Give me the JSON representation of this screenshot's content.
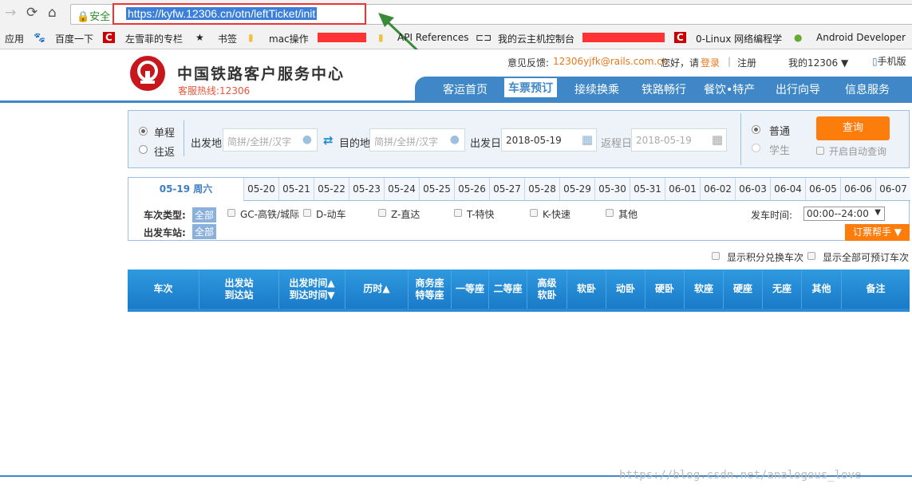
{
  "browser": {
    "secure_label": "安全",
    "url": "https://kyfw.12306.cn/otn/leftTicket/init",
    "bookmarks": [
      "应用",
      "百度一下",
      "左雪菲的专栏",
      "书签",
      "mac操作",
      "API References",
      "我的云主机控制台",
      "0-Linux 网络编程学",
      "Android Developer"
    ]
  },
  "header": {
    "logo_title": "中国铁路客户服务中心",
    "hotline": "客服热线:12306",
    "feedback_label": "意见反馈:",
    "feedback_email": "12306yjfk@rails.com.cn",
    "greeting": "您好，请",
    "login": "登录",
    "sep": "|",
    "register": "注册",
    "my12306": "我的12306",
    "mobile": "手机版",
    "nav": [
      "客运首页",
      "车票预订",
      "接续换乘",
      "铁路畅行",
      "餐饮•特产",
      "出行向导",
      "信息服务"
    ],
    "active_nav": "车票预订"
  },
  "search": {
    "one_way": "单程",
    "round_trip": "往返",
    "from_label": "出发地",
    "from_placeholder": "简拼/全拼/汉字",
    "to_label": "目的地",
    "to_placeholder": "简拼/全拼/汉字",
    "depart_label": "出发日",
    "depart_date": "2018-05-19",
    "return_label": "返程日",
    "return_date": "2018-05-19",
    "normal": "普通",
    "student": "学生",
    "query": "查询",
    "auto_query": "开启自动查询"
  },
  "dates": {
    "active": "05-19 周六",
    "tabs": [
      "05-20",
      "05-21",
      "05-22",
      "05-23",
      "05-24",
      "05-25",
      "05-26",
      "05-27",
      "05-28",
      "05-29",
      "05-30",
      "05-31",
      "06-01",
      "06-02",
      "06-03",
      "06-04",
      "06-05",
      "06-06",
      "06-07"
    ]
  },
  "filters": {
    "type_label": "车次类型:",
    "all": "全部",
    "types": [
      "GC-高铁/城际",
      "D-动车",
      "Z-直达",
      "T-特快",
      "K-快速",
      "其他"
    ],
    "station_label": "出发车站:",
    "time_label": "发车时间:",
    "time_value": "00:00--24:00",
    "helper": "订票帮手 ▼",
    "show_points": "显示积分兑换车次",
    "show_all": "显示全部可预订车次"
  },
  "table": {
    "columns": [
      [
        "车次"
      ],
      [
        "出发站",
        "到达站"
      ],
      [
        "出发时间▲",
        "到达时间▼"
      ],
      [
        "历时▲"
      ],
      [
        "商务座",
        "特等座"
      ],
      [
        "一等座"
      ],
      [
        "二等座"
      ],
      [
        "高级",
        "软卧"
      ],
      [
        "软卧"
      ],
      [
        "动卧"
      ],
      [
        "硬卧"
      ],
      [
        "软座"
      ],
      [
        "硬座"
      ],
      [
        "无座"
      ],
      [
        "其他"
      ],
      [
        "备注"
      ]
    ]
  },
  "watermark": "https://blog.csdn.net/analogous_love",
  "colors": {
    "brand_blue": "#3f87c6",
    "orange": "#fc7c0c",
    "annotation_red": "#ee3333",
    "arrow_green": "#3a8a3a"
  }
}
